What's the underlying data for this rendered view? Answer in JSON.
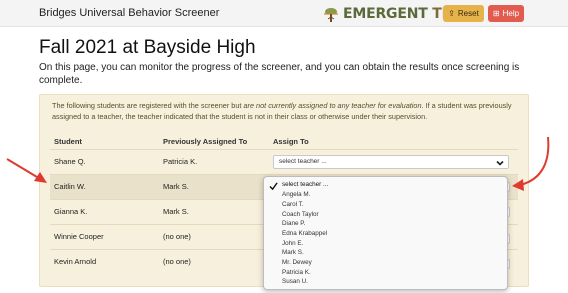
{
  "app_title": "Bridges Universal Behavior Screener",
  "logo": {
    "text_a": "EMERGENT",
    "text_b": "TREE",
    "icon": "tree-icon"
  },
  "toolbar": {
    "reset_label": "Reset",
    "help_label": "Help",
    "reset_icon": "upload-icon",
    "help_icon": "plus-square-icon"
  },
  "page_title": "Fall 2021 at Bayside High",
  "intro": "On this page, you can monitor the progress of the screener, and you can obtain the results once screening is complete.",
  "notice": {
    "part1": "The following students are registered with the screener but ",
    "emph": "are not currently assigned to any teacher for evaluation",
    "part2": ". If a student was previously assigned to a teacher, the teacher indicated that the student is not in their class or otherwise under their supervision."
  },
  "table": {
    "headers": {
      "student": "Student",
      "previous": "Previously Assigned To",
      "assign": "Assign To"
    },
    "rows": [
      {
        "student": "Shane Q.",
        "previous": "Patricia K.",
        "select": "select teacher ..."
      },
      {
        "student": "Caitlin W.",
        "previous": "Mark S.",
        "select": "select teacher ..."
      },
      {
        "student": "Gianna K.",
        "previous": "Mark S.",
        "select": "select teacher ..."
      },
      {
        "student": "Winnie Cooper",
        "previous": "(no one)",
        "select": "select teacher ..."
      },
      {
        "student": "Kevin Arnold",
        "previous": "(no one)",
        "select": "select teacher ..."
      }
    ]
  },
  "dropdown": {
    "options": [
      "select teacher ...",
      "Angela M.",
      "Carol T.",
      "Coach Taylor",
      "Diane P.",
      "Edna Krabappel",
      "John E.",
      "Mark S.",
      "Mr. Dewey",
      "Patricia K.",
      "Susan U."
    ],
    "selected_index": 0
  },
  "colors": {
    "reset": "#e6b24a",
    "help": "#e15b4e",
    "panel": "#f7f0dc",
    "annotation_arrow": "#e0392f"
  }
}
